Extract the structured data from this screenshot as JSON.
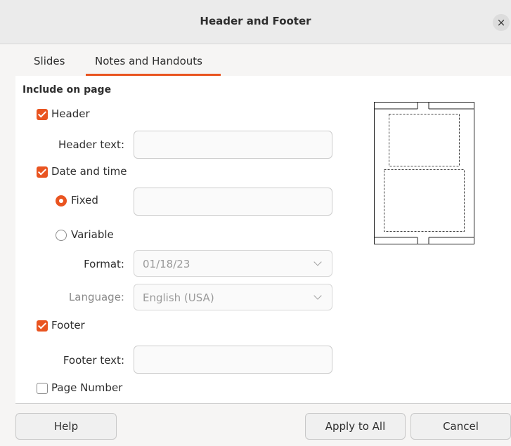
{
  "window": {
    "title": "Header and Footer",
    "close_label": "×"
  },
  "tabs": [
    {
      "label": "Slides",
      "active": false
    },
    {
      "label": "Notes and Handouts",
      "active": true
    }
  ],
  "include": {
    "section_title": "Include on page",
    "header": {
      "label": "Header",
      "checked": true,
      "text_label": "Header text:",
      "text_value": ""
    },
    "datetime": {
      "label": "Date and time",
      "checked": true,
      "fixed_label": "Fixed",
      "fixed_value": "",
      "variable_label": "Variable",
      "selected": "Fixed",
      "format_label": "Format:",
      "format_value": "01/18/23",
      "language_label": "Language:",
      "language_value": "English (USA)"
    },
    "footer": {
      "label": "Footer",
      "checked": true,
      "text_label": "Footer text:",
      "text_value": ""
    },
    "page_number": {
      "label": "Page Number",
      "checked": false
    }
  },
  "buttons": {
    "help": "Help",
    "apply_all": "Apply to All",
    "cancel": "Cancel"
  },
  "colors": {
    "accent": "#e95420"
  }
}
